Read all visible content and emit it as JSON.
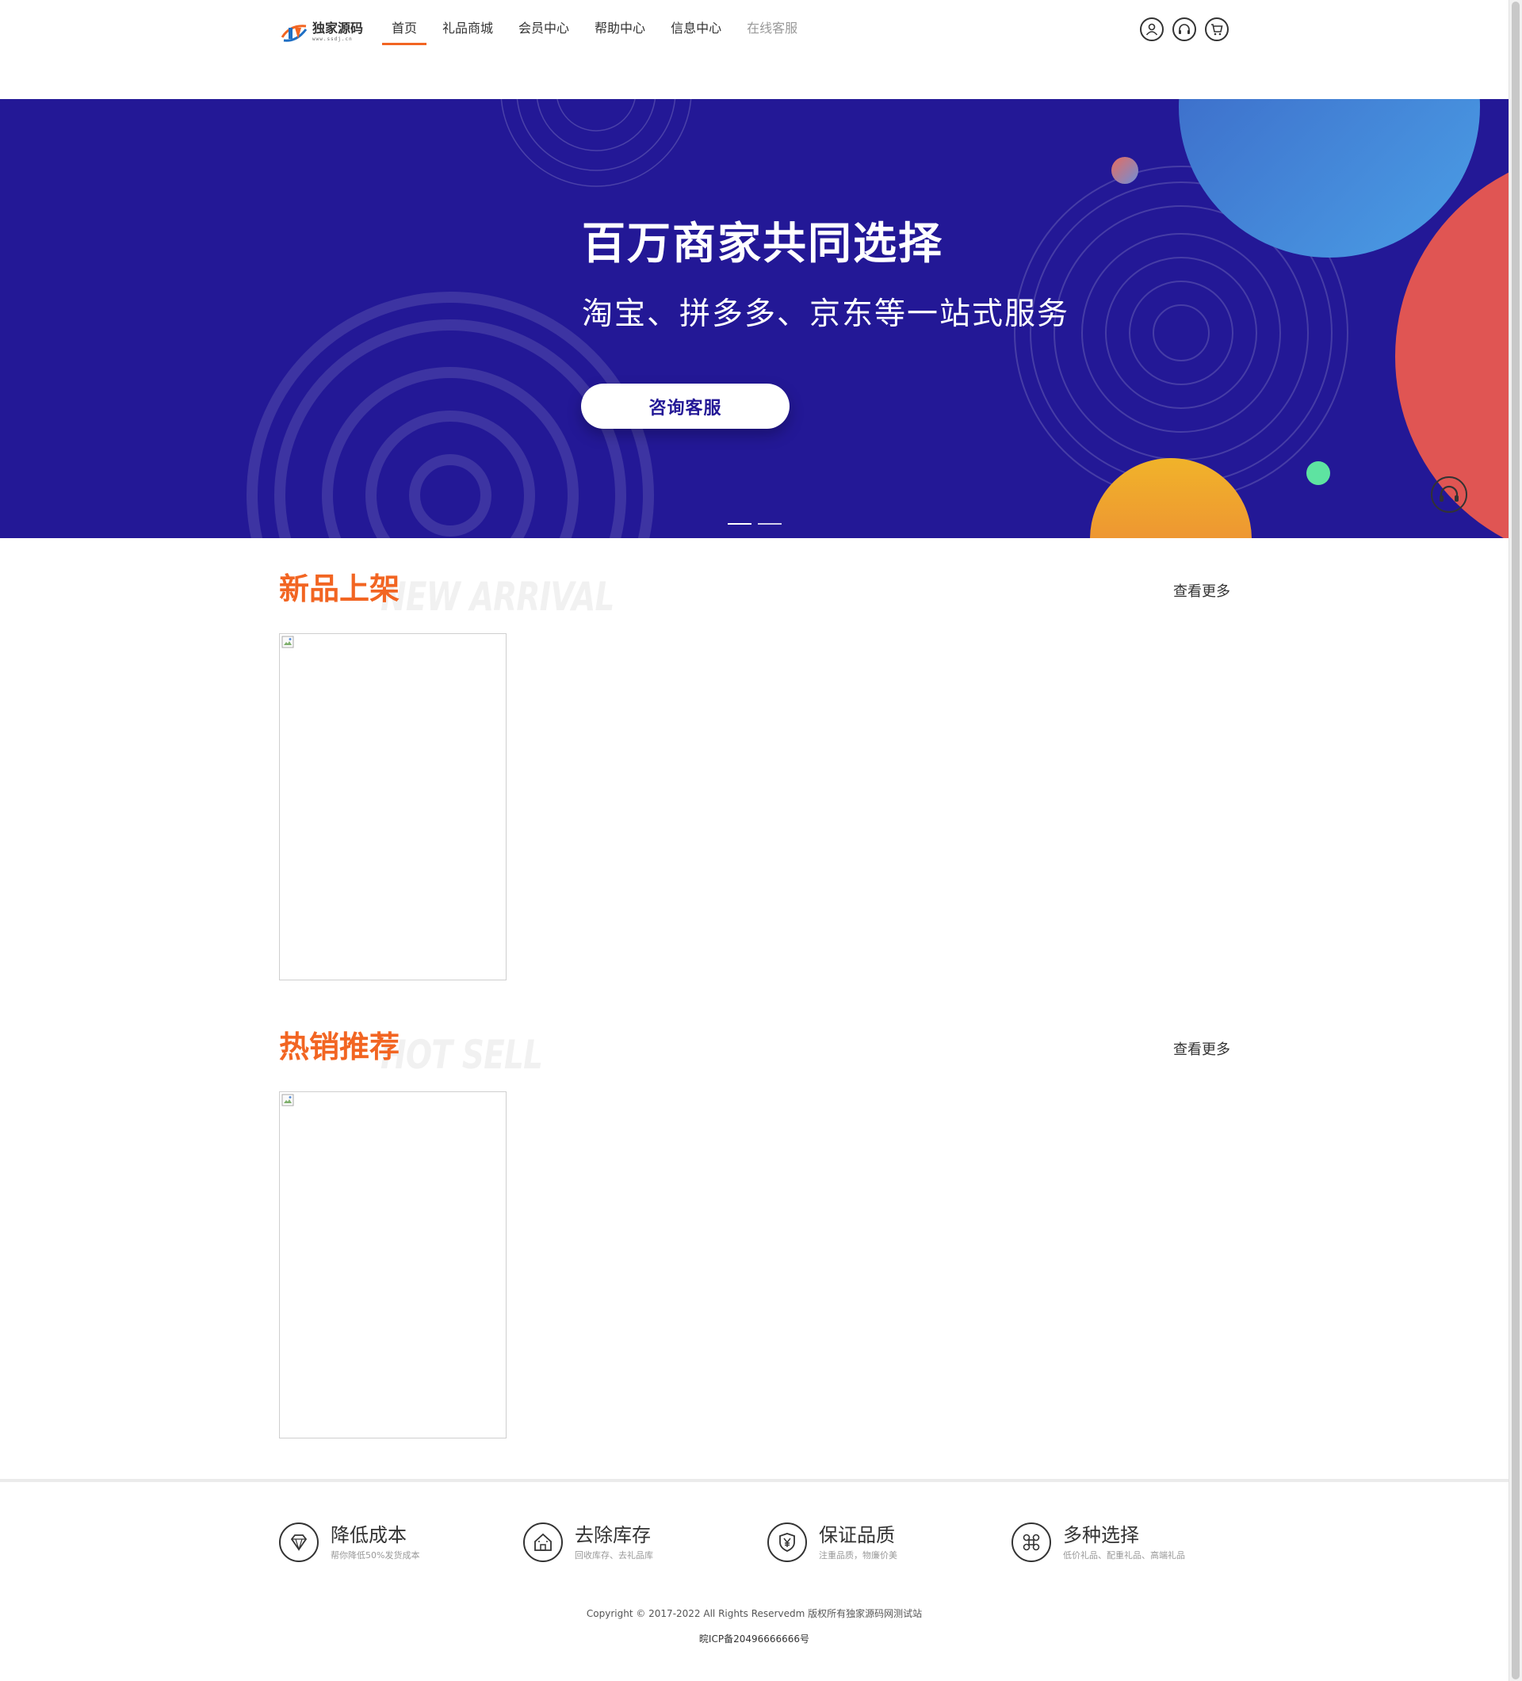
{
  "header": {
    "logo": {
      "text": "独家源码",
      "sub": "www.ssdj.cn"
    },
    "nav": [
      {
        "label": "首页",
        "active": true
      },
      {
        "label": "礼品商城",
        "active": false
      },
      {
        "label": "会员中心",
        "active": false
      },
      {
        "label": "帮助中心",
        "active": false
      },
      {
        "label": "信息中心",
        "active": false
      },
      {
        "label": "在线客服",
        "active": false
      }
    ],
    "icons": [
      "user-icon",
      "headset-icon",
      "cart-icon"
    ]
  },
  "banner": {
    "title": "百万商家共同选择",
    "subtitle": "淘宝、拼多多、京东等一站式服务",
    "button": "咨询客服",
    "slide_count": 2,
    "background": "#231896"
  },
  "sections": {
    "new_arrival": {
      "title": "新品上架",
      "en": "NEW ARRIVAL",
      "more": "查看更多"
    },
    "hot_sell": {
      "title": "热销推荐",
      "en": "HOT SELL",
      "more": "查看更多"
    }
  },
  "features": [
    {
      "icon": "diamond-icon",
      "title": "降低成本",
      "desc": "帮你降低50%发货成本"
    },
    {
      "icon": "house-icon",
      "title": "去除库存",
      "desc": "回收库存、去礼品库"
    },
    {
      "icon": "yen-shield-icon",
      "title": "保证品质",
      "desc": "注重品质，物廉价美"
    },
    {
      "icon": "command-icon",
      "title": "多种选择",
      "desc": "低价礼品、配重礼品、高端礼品"
    }
  ],
  "footer": {
    "copyright": "Copyright © 2017-2022 All Rights Reservedm 版权所有独家源码网测试站",
    "icp": "晥ICP备20496666666号"
  },
  "colors": {
    "accent": "#f26522",
    "banner": "#231896"
  }
}
